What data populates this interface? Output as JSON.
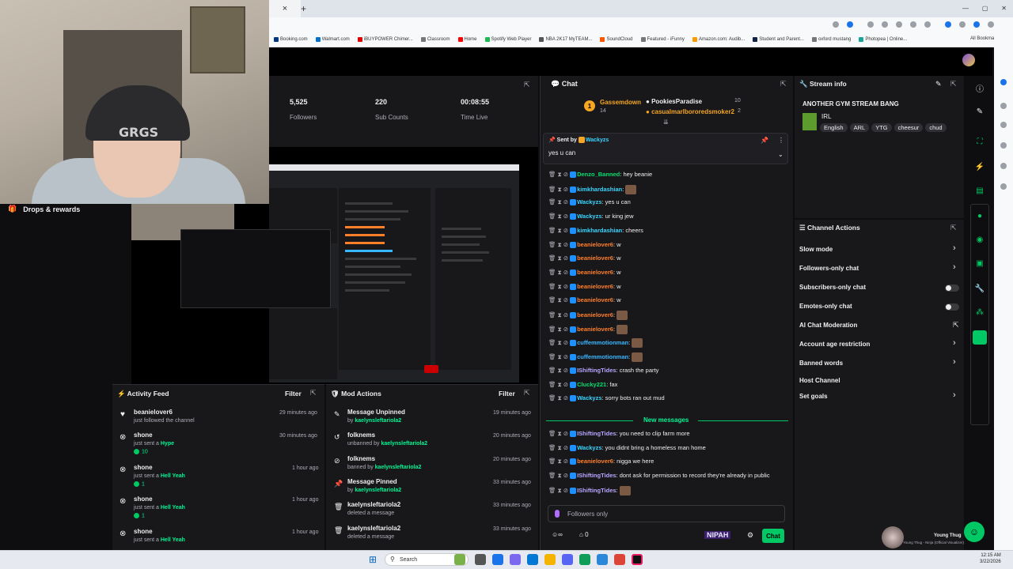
{
  "browser": {
    "tab_close": "×",
    "tab_new": "+",
    "bookmarks": [
      "Booking.com",
      "Walmart.com",
      "iBUYPOWER Chimer...",
      "Classroom",
      "Home",
      "Spotify Web Player",
      "NBA 2K17 MyTEAM...",
      "SoundCloud",
      "Featured - iFunny",
      "Amazon.com: Audib...",
      "Student and Parent...",
      "oxford mustang",
      "Photopea | Online..."
    ],
    "all_bookmarks": "All Bookmarks"
  },
  "leftnav": {
    "drops_label": "Drops & rewards"
  },
  "stats": {
    "followers_value": "5,525",
    "followers_label": "Followers",
    "subs_value": "220",
    "subs_label": "Sub Counts",
    "time_value": "00:08:55",
    "time_label": "Time Live"
  },
  "activity_feed": {
    "title": "Activity Feed",
    "filter": "Filter",
    "items": [
      {
        "name": "beanielover6",
        "sub": "just followed the channel",
        "time": "29 minutes ago"
      },
      {
        "name": "shone",
        "sub": "just sent a",
        "reward": "Hype",
        "count": "10",
        "time": "30 minutes ago"
      },
      {
        "name": "shone",
        "sub": "just sent a",
        "reward": "Hell Yeah",
        "count": "1",
        "time": "1 hour ago"
      },
      {
        "name": "shone",
        "sub": "just sent a",
        "reward": "Hell Yeah",
        "count": "1",
        "time": "1 hour ago"
      },
      {
        "name": "shone",
        "sub": "just sent a",
        "reward": "Hell Yeah",
        "time": "1 hour ago"
      }
    ]
  },
  "mod_actions": {
    "title": "Mod Actions",
    "filter": "Filter",
    "items": [
      {
        "name": "Message Unpinned",
        "prefix": "by",
        "actor": "kaelynsleftariola2",
        "time": "19 minutes ago"
      },
      {
        "name": "folknems",
        "prefix": "unbanned by",
        "actor": "kaelynsleftariola2",
        "time": "20 minutes ago"
      },
      {
        "name": "folknems",
        "prefix": "banned by",
        "actor": "kaelynsleftariola2",
        "time": "20 minutes ago"
      },
      {
        "name": "Message Pinned",
        "prefix": "by",
        "actor": "kaelynsleftariola2",
        "time": "33 minutes ago"
      },
      {
        "name": "kaelynsleftariola2",
        "prefix": "deleted a message",
        "actor": "",
        "time": "33 minutes ago"
      },
      {
        "name": "kaelynsleftariola2",
        "prefix": "deleted a message",
        "actor": "",
        "time": "33 minutes ago"
      }
    ]
  },
  "chat": {
    "title": "Chat",
    "leaderboard": {
      "rank": "1",
      "first_name": "Gassemdown",
      "first_count": "14",
      "second_name": "PookiesParadise",
      "second_count": "10",
      "third_name": "casualmarlbororedsmoker2",
      "third_count": "2"
    },
    "pinned": {
      "label": "Sent by",
      "user": "Wackyzs",
      "text": "yes u can"
    },
    "messages": [
      {
        "user": "Denzo_Banned",
        "color": "#00e06f",
        "text": "hey beanie"
      },
      {
        "user": "kimkhardashian",
        "color": "#38d6ff",
        "text": ""
      },
      {
        "user": "Wackyzs",
        "color": "#38d6ff",
        "text": "yes u can"
      },
      {
        "user": "Wackyzs",
        "color": "#38d6ff",
        "text": "ur king jew"
      },
      {
        "user": "kimkhardashian",
        "color": "#38d6ff",
        "text": "cheers"
      },
      {
        "user": "beanielover6",
        "color": "#ff7f2a",
        "text": "w"
      },
      {
        "user": "beanielover6",
        "color": "#ff7f2a",
        "text": "w"
      },
      {
        "user": "beanielover6",
        "color": "#ff7f2a",
        "text": "w"
      },
      {
        "user": "beanielover6",
        "color": "#ff7f2a",
        "text": "w"
      },
      {
        "user": "beanielover6",
        "color": "#ff7f2a",
        "text": "w"
      },
      {
        "user": "beanielover6",
        "color": "#ff7f2a",
        "text": ""
      },
      {
        "user": "beanielover6",
        "color": "#ff7f2a",
        "text": ""
      },
      {
        "user": "cuffemmotionman",
        "color": "#38b6ff",
        "text": ""
      },
      {
        "user": "cuffemmotionman",
        "color": "#38b6ff",
        "text": ""
      },
      {
        "user": "IShiftingTides",
        "color": "#b9a6ff",
        "text": "crash the party"
      },
      {
        "user": "Clucky221",
        "color": "#00e06f",
        "text": "fax"
      },
      {
        "user": "Wackyzs",
        "color": "#38d6ff",
        "text": "sorry bots ran out mud"
      }
    ],
    "new_messages_label": "New messages",
    "new_messages": [
      {
        "user": "IShiftingTides",
        "color": "#b9a6ff",
        "text": "you need to clip farm more"
      },
      {
        "user": "Wackyzs",
        "color": "#38d6ff",
        "text": "you didnt bring a homeless man home"
      },
      {
        "user": "beanielover6",
        "color": "#ff7f2a",
        "text": "nigga we here"
      },
      {
        "user": "IShiftingTides",
        "color": "#b9a6ff",
        "text": "dont ask for permission to record they're already in public"
      },
      {
        "user": "IShiftingTides",
        "color": "#b9a6ff",
        "text": ""
      }
    ],
    "input_placeholder": "Followers only",
    "viewer_count": "0",
    "loop_count": "0",
    "brand_badge": "NIPAH",
    "send_label": "Chat"
  },
  "stream_info": {
    "title_label": "Stream info",
    "stream_title": "ANOTHER GYM STREAM BANG",
    "category": "IRL",
    "tags": [
      "English",
      "ARL",
      "YTG",
      "cheesur",
      "chud"
    ]
  },
  "channel_actions": {
    "title": "Channel Actions",
    "items": [
      {
        "label": "Slow mode",
        "control": "chevron"
      },
      {
        "label": "Followers-only chat",
        "control": "chevron"
      },
      {
        "label": "Subscribers-only chat",
        "control": "toggle"
      },
      {
        "label": "Emotes-only chat",
        "control": "toggle"
      },
      {
        "label": "AI Chat Moderation",
        "control": "external"
      },
      {
        "label": "Account age restriction",
        "control": "chevron"
      },
      {
        "label": "Banned words",
        "control": "chevron"
      },
      {
        "label": "Host Channel",
        "control": "none"
      },
      {
        "label": "Set goals",
        "control": "chevron"
      }
    ]
  },
  "now_playing": {
    "artist": "Young Thug",
    "track": "Young Thug - Ninja (Official Visualizer)"
  },
  "taskbar": {
    "search_placeholder": "Search",
    "time": "12:15 AM",
    "date": "3/22/2026"
  },
  "webcam": {
    "hat_text": "GRGS"
  },
  "colors": {
    "accent": "#00c864",
    "panel": "#18181b",
    "bg": "#0e0e10"
  }
}
